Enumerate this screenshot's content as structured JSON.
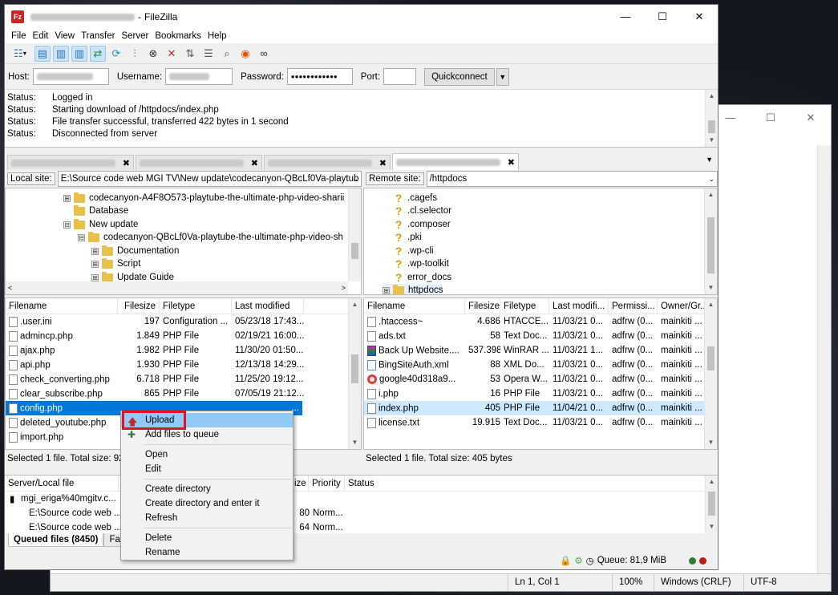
{
  "app": {
    "title": "FileZilla",
    "icon_text": "Fz"
  },
  "window_controls": {
    "minimize": "—",
    "maximize": "☐",
    "close": "✕"
  },
  "menu": [
    "File",
    "Edit",
    "View",
    "Transfer",
    "Server",
    "Bookmarks",
    "Help"
  ],
  "quickconnect": {
    "host_label": "Host:",
    "username_label": "Username:",
    "password_label": "Password:",
    "password_value": "●●●●●●●●●●●●",
    "port_label": "Port:",
    "button": "Quickconnect",
    "dropdown": "▼"
  },
  "log": [
    {
      "k": "Status:",
      "v": "Logged in"
    },
    {
      "k": "Status:",
      "v": "Starting download of /httpdocs/index.php"
    },
    {
      "k": "Status:",
      "v": "File transfer successful, transferred 422 bytes in 1 second"
    },
    {
      "k": "Status:",
      "v": "Disconnected from server"
    }
  ],
  "tab_close": "✖",
  "local": {
    "site_label": "Local site:",
    "path": "E:\\Source code web MGI TV\\New update\\codecanyon-QBcLf0Va-playtub",
    "tree": [
      {
        "pm": "⊞",
        "name": "codecanyon-A4F8O573-playtube-the-ultimate-php-video-sharii"
      },
      {
        "pm": "",
        "name": "Database"
      },
      {
        "pm": "⊟",
        "name": "New update"
      },
      {
        "pm": "⊟",
        "name": "codecanyon-QBcLf0Va-playtube-the-ultimate-php-video-sh"
      },
      {
        "pm": "⊞",
        "name": "Documentation"
      },
      {
        "pm": "⊞",
        "name": "Script"
      },
      {
        "pm": "⊞",
        "name": "Update Guide"
      }
    ],
    "columns": [
      "Filename",
      "Filesize",
      "Filetype",
      "Last modified"
    ],
    "files": [
      {
        "name": ".user.ini",
        "size": "197",
        "type": "Configuration ...",
        "mod": "05/23/18 17:43..."
      },
      {
        "name": "admincp.php",
        "size": "1.849",
        "type": "PHP File",
        "mod": "02/19/21 16:00..."
      },
      {
        "name": "ajax.php",
        "size": "1.982",
        "type": "PHP File",
        "mod": "11/30/20 01:50..."
      },
      {
        "name": "api.php",
        "size": "1.930",
        "type": "PHP File",
        "mod": "12/13/18 14:29..."
      },
      {
        "name": "check_converting.php",
        "size": "6.718",
        "type": "PHP File",
        "mod": "11/25/20 19:12..."
      },
      {
        "name": "clear_subscribe.php",
        "size": "865",
        "type": "PHP File",
        "mod": "07/05/19 21:12..."
      },
      {
        "name": "config.php",
        "size": "",
        "type": "",
        "mod": "..."
      },
      {
        "name": "deleted_youtube.php",
        "size": "",
        "type": "",
        "mod": ""
      },
      {
        "name": "import.php",
        "size": "",
        "type": "",
        "mod": ""
      }
    ],
    "status": "Selected 1 file. Total size: 92"
  },
  "remote": {
    "site_label": "Remote site:",
    "path": "/httpdocs",
    "tree": [
      {
        "icon": "q",
        "name": ".cagefs"
      },
      {
        "icon": "q",
        "name": ".cl.selector"
      },
      {
        "icon": "q",
        "name": ".composer"
      },
      {
        "icon": "q",
        "name": ".pki"
      },
      {
        "icon": "q",
        "name": ".wp-cli"
      },
      {
        "icon": "q",
        "name": ".wp-toolkit"
      },
      {
        "icon": "q",
        "name": "error_docs"
      },
      {
        "icon": "f",
        "name": "httpdocs"
      }
    ],
    "columns": [
      "Filename",
      "Filesize",
      "Filetype",
      "Last modifi...",
      "Permissi...",
      "Owner/Gr..."
    ],
    "files": [
      {
        "name": ".htaccess~",
        "size": "4.686",
        "type": "HTACCE...",
        "mod": "11/03/21 0...",
        "perm": "adfrw (0...",
        "owner": "mainkiti ...",
        "icon": ""
      },
      {
        "name": "ads.txt",
        "size": "58",
        "type": "Text Doc...",
        "mod": "11/03/21 0...",
        "perm": "adfrw (0...",
        "owner": "mainkiti ...",
        "icon": ""
      },
      {
        "name": "Back Up Website....",
        "size": "537.398...",
        "type": "WinRAR ...",
        "mod": "11/03/21 1...",
        "perm": "adfrw (0...",
        "owner": "mainkiti ...",
        "icon": "rar"
      },
      {
        "name": "BingSiteAuth.xml",
        "size": "88",
        "type": "XML Do...",
        "mod": "11/03/21 0...",
        "perm": "adfrw (0...",
        "owner": "mainkiti ...",
        "icon": "xml"
      },
      {
        "name": "google40d318a9...",
        "size": "53",
        "type": "Opera W...",
        "mod": "11/03/21 0...",
        "perm": "adfrw (0...",
        "owner": "mainkiti ...",
        "icon": "opera"
      },
      {
        "name": "i.php",
        "size": "16",
        "type": "PHP File",
        "mod": "11/03/21 0...",
        "perm": "adfrw (0...",
        "owner": "mainkiti ...",
        "icon": ""
      },
      {
        "name": "index.php",
        "size": "405",
        "type": "PHP File",
        "mod": "11/04/21 0...",
        "perm": "adfrw (0...",
        "owner": "mainkiti ...",
        "icon": ""
      },
      {
        "name": "license.txt",
        "size": "19.915",
        "type": "Text Doc...",
        "mod": "11/03/21 0...",
        "perm": "adfrw (0...",
        "owner": "mainkiti ...",
        "icon": ""
      }
    ],
    "status": "Selected 1 file. Total size: 405 bytes"
  },
  "queue": {
    "columns": [
      "Server/Local file",
      "Size",
      "Priority",
      "Status"
    ],
    "size_col_visible": "ize",
    "rows": [
      {
        "file": "mgi_eriga%40mgitv.c...",
        "size": "",
        "prio": ""
      },
      {
        "file": "E:\\Source code web ...",
        "size": "80",
        "prio": "Norm..."
      },
      {
        "file": "E:\\Source code web ...",
        "size": "64",
        "prio": "Norm..."
      }
    ],
    "tabs": [
      "Queued files (8450)",
      "Faile"
    ],
    "status_text": "Queue: 81,9 MiB"
  },
  "context_menu": {
    "items": [
      {
        "label": "Upload",
        "icon": "🡅"
      },
      {
        "label": "Add files to queue",
        "icon": "✚"
      },
      {
        "sep": true
      },
      {
        "label": "Open"
      },
      {
        "label": "Edit"
      },
      {
        "sep": true
      },
      {
        "label": "Create directory"
      },
      {
        "label": "Create directory and enter it"
      },
      {
        "label": "Refresh"
      },
      {
        "sep": true
      },
      {
        "label": "Delete"
      },
      {
        "label": "Rename"
      }
    ]
  },
  "notepad": {
    "status": [
      "Ln 1, Col 1",
      "100%",
      "Windows (CRLF)",
      "UTF-8"
    ]
  },
  "colors": {
    "selection": "#0078d7",
    "menu_highlight": "#91c9f7",
    "annotation": "#e0141e"
  }
}
